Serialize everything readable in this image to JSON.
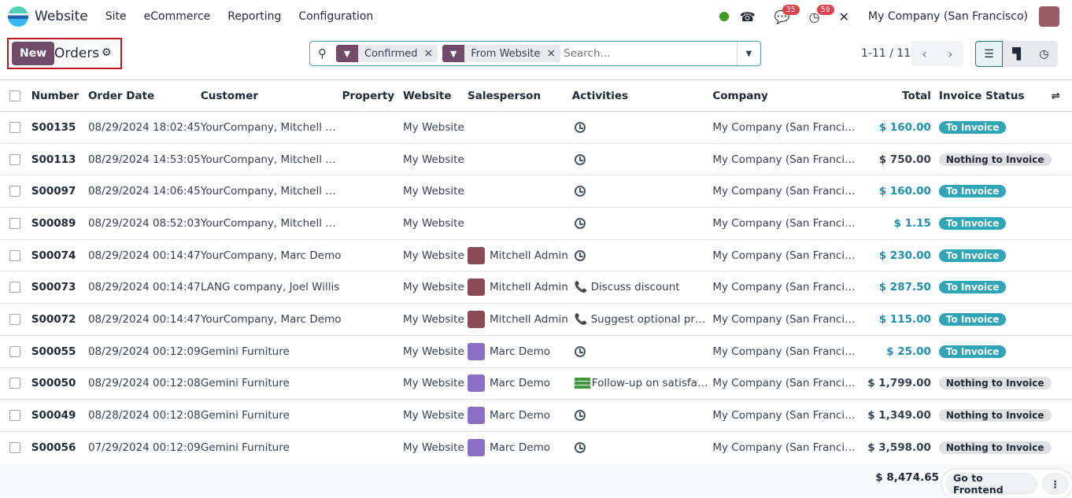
{
  "nav": {
    "app": "Website",
    "menus": [
      "Site",
      "eCommerce",
      "Reporting",
      "Configuration"
    ],
    "messages_count": "35",
    "activities_count": "59",
    "company": "My Company (San Francisco)"
  },
  "control": {
    "new_label": "New",
    "title": "Orders"
  },
  "search": {
    "facets": [
      "Confirmed",
      "From Website"
    ],
    "placeholder": "Search..."
  },
  "pager": {
    "text": "1-11 / 11"
  },
  "columns": [
    "Number",
    "Order Date",
    "Customer",
    "Property",
    "Website",
    "Salesperson",
    "Activities",
    "Company",
    "Total",
    "Invoice Status"
  ],
  "rows": [
    {
      "number": "S00135",
      "date": "08/29/2024 18:02:45",
      "customer": "YourCompany, Mitchell …",
      "website": "My Website",
      "salesperson": "",
      "activity_type": "clock",
      "activity": "",
      "company": "My Company (San Franci…",
      "total": "$ 160.00",
      "status": "To Invoice"
    },
    {
      "number": "S00113",
      "date": "08/29/2024 14:53:05",
      "customer": "YourCompany, Mitchell …",
      "website": "My Website",
      "salesperson": "",
      "activity_type": "clock",
      "activity": "",
      "company": "My Company (San Franci…",
      "total": "$ 750.00",
      "status": "Nothing to Invoice"
    },
    {
      "number": "S00097",
      "date": "08/29/2024 14:06:45",
      "customer": "YourCompany, Mitchell …",
      "website": "My Website",
      "salesperson": "",
      "activity_type": "clock",
      "activity": "",
      "company": "My Company (San Franci…",
      "total": "$ 160.00",
      "status": "To Invoice"
    },
    {
      "number": "S00089",
      "date": "08/29/2024 08:52:03",
      "customer": "YourCompany, Mitchell …",
      "website": "My Website",
      "salesperson": "",
      "activity_type": "clock",
      "activity": "",
      "company": "My Company (San Franci…",
      "total": "$ 1.15",
      "status": "To Invoice"
    },
    {
      "number": "S00074",
      "date": "08/29/2024 00:14:47",
      "customer": "YourCompany, Marc Demo",
      "website": "My Website",
      "salesperson": "Mitchell Admin",
      "activity_type": "clock",
      "activity": "",
      "company": "My Company (San Franci…",
      "total": "$ 230.00",
      "status": "To Invoice"
    },
    {
      "number": "S00073",
      "date": "08/29/2024 00:14:47",
      "customer": "LANG company, Joel Willis",
      "website": "My Website",
      "salesperson": "Mitchell Admin",
      "activity_type": "phone",
      "activity": "Discuss discount",
      "company": "My Company (San Franci…",
      "total": "$ 287.50",
      "status": "To Invoice"
    },
    {
      "number": "S00072",
      "date": "08/29/2024 00:14:47",
      "customer": "YourCompany, Marc Demo",
      "website": "My Website",
      "salesperson": "Mitchell Admin",
      "activity_type": "phone",
      "activity": "Suggest optional pr…",
      "company": "My Company (San Franci…",
      "total": "$ 115.00",
      "status": "To Invoice"
    },
    {
      "number": "S00055",
      "date": "08/29/2024 00:12:09",
      "customer": "Gemini Furniture",
      "website": "My Website",
      "salesperson": "Marc Demo",
      "activity_type": "clock",
      "activity": "",
      "company": "My Company (San Franci…",
      "total": "$ 25.00",
      "status": "To Invoice"
    },
    {
      "number": "S00050",
      "date": "08/29/2024 00:12:08",
      "customer": "Gemini Furniture",
      "website": "My Website",
      "salesperson": "Marc Demo",
      "activity_type": "todo",
      "activity": "Follow-up on satisfa…",
      "company": "My Company (San Franci…",
      "total": "$ 1,799.00",
      "status": "Nothing to Invoice"
    },
    {
      "number": "S00049",
      "date": "08/28/2024 00:12:08",
      "customer": "Gemini Furniture",
      "website": "My Website",
      "salesperson": "Marc Demo",
      "activity_type": "clock",
      "activity": "",
      "company": "My Company (San Franci…",
      "total": "$ 1,349.00",
      "status": "Nothing to Invoice"
    },
    {
      "number": "S00056",
      "date": "07/29/2024 00:12:09",
      "customer": "Gemini Furniture",
      "website": "My Website",
      "salesperson": "Marc Demo",
      "activity_type": "clock",
      "activity": "",
      "company": "My Company (San Franci…",
      "total": "$ 3,598.00",
      "status": "Nothing to Invoice"
    }
  ],
  "footer": {
    "grand_total": "$ 8,474.65",
    "frontend_label": "Go to Frontend"
  },
  "colors": {
    "brand": "#714b67",
    "to_invoice": "#2ea6b8",
    "total_blue": "#1c8fb5"
  }
}
